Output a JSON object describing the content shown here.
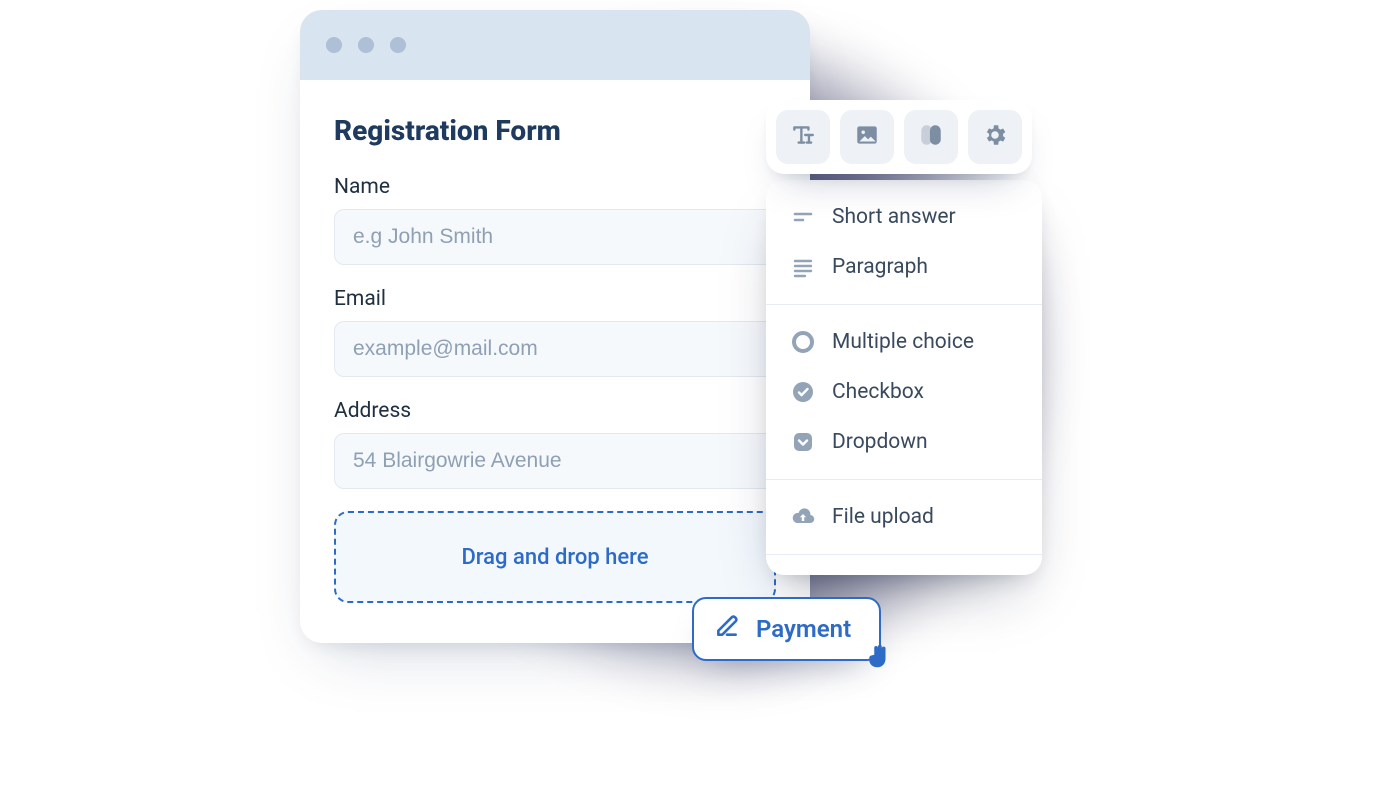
{
  "form": {
    "title": "Registration Form",
    "fields": [
      {
        "label": "Name",
        "placeholder": "e.g John Smith"
      },
      {
        "label": "Email",
        "placeholder": "example@mail.com"
      },
      {
        "label": "Address",
        "placeholder": "54 Blairgowrie Avenue"
      }
    ],
    "dropzone_text": "Drag and drop here"
  },
  "toolbar": {
    "items": [
      "text",
      "image",
      "theme",
      "settings"
    ]
  },
  "panel": {
    "groups": [
      [
        "Short answer",
        "Paragraph"
      ],
      [
        "Multiple choice",
        "Checkbox",
        "Dropdown"
      ],
      [
        "File upload"
      ]
    ]
  },
  "chip": {
    "label": "Payment"
  }
}
